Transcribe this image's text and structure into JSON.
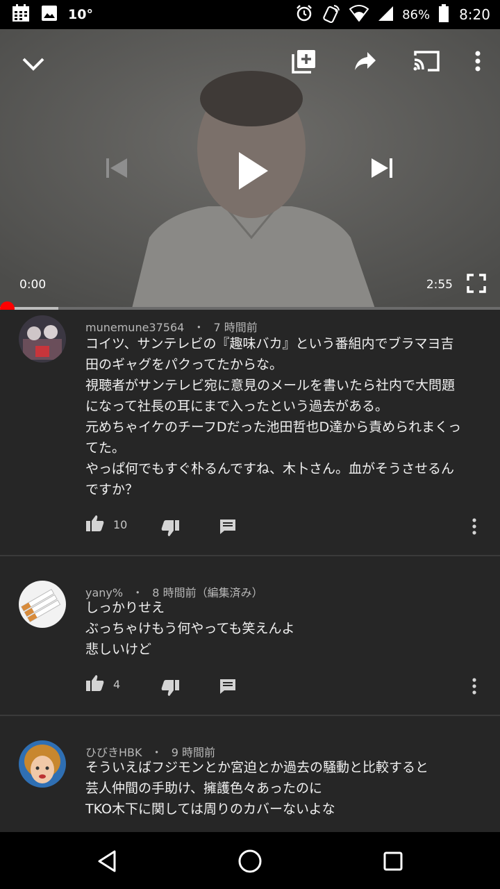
{
  "status_bar": {
    "temperature": "10°",
    "battery_percent": "86%",
    "time": "8:20",
    "icons": [
      "calendar-icon",
      "image-icon",
      "alarm-icon",
      "nfc-icon",
      "wifi-icon",
      "signal-icon",
      "battery-icon"
    ]
  },
  "player": {
    "current_time": "0:00",
    "duration": "2:55",
    "progress_fraction": 0.0,
    "buffer_fraction": 0.105,
    "icons": [
      "chevron-down-icon",
      "add-to-playlist-icon",
      "share-icon",
      "cast-icon",
      "more-vert-icon",
      "skip-previous-icon",
      "play-icon",
      "skip-next-icon",
      "fullscreen-icon"
    ]
  },
  "comments": [
    {
      "author": "munemune37564",
      "time": "7 時間前",
      "lines": [
        "コイツ、サンテレビの『趣味バカ』という番組内でブラマヨ吉",
        "田のギャグをパクってたからな。",
        "視聴者がサンテレビ宛に意見のメールを書いたら社内で大問題",
        "になって社長の耳にまで入ったという過去がある。",
        "元めちゃイケのチーフDだった池田哲也D達から責められまくっ",
        "てた。",
        "やっぱ何でもすぐ朴るんですね、木卜さん。血がそうさせるん",
        "ですか？"
      ],
      "likes": "10"
    },
    {
      "author": "yany%",
      "time": "8 時間前（編集済み）",
      "lines": [
        "しっかりせえ",
        "ぶっちゃけもう何やっても笑えんよ",
        "悲しいけど"
      ],
      "likes": "4"
    },
    {
      "author": "ひびきHBK",
      "time": "9 時間前",
      "lines": [
        "そういえばフジモンとか宮迫とか過去の騒動と比較すると",
        "芸人仲間の手助け、擁護色々あったのに",
        "TKO木下に関しては周りのカバーないよな"
      ],
      "likes": ""
    }
  ],
  "separator": "・",
  "colors": {
    "progress_played": "#ff0000",
    "background": "#262626",
    "text": "#f1f1f1",
    "meta": "#b8b8b8"
  },
  "navbar": {
    "icons": [
      "back-icon",
      "home-icon",
      "recents-icon"
    ]
  }
}
